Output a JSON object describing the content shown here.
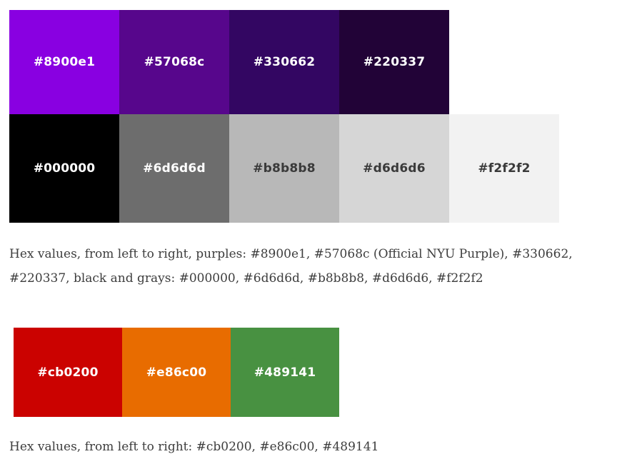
{
  "palettes": [
    {
      "swatches": [
        {
          "label": "#8900e1",
          "color": "#8900e1",
          "text_color": "#ffffff"
        },
        {
          "label": "#57068c",
          "color": "#57068c",
          "text_color": "#ffffff"
        },
        {
          "label": "#330662",
          "color": "#330662",
          "text_color": "#ffffff"
        },
        {
          "label": "#220337",
          "color": "#220337",
          "text_color": "#ffffff"
        }
      ]
    },
    {
      "swatches": [
        {
          "label": "#000000",
          "color": "#000000",
          "text_color": "#ffffff"
        },
        {
          "label": "#6d6d6d",
          "color": "#6d6d6d",
          "text_color": "#ffffff"
        },
        {
          "label": "#b8b8b8",
          "color": "#b8b8b8",
          "text_color": "#3a3a3a"
        },
        {
          "label": "#d6d6d6",
          "color": "#d6d6d6",
          "text_color": "#3a3a3a"
        },
        {
          "label": "#f2f2f2",
          "color": "#f2f2f2",
          "text_color": "#3a3a3a"
        }
      ]
    },
    {
      "swatches": [
        {
          "label": "#cb0200",
          "color": "#cb0200",
          "text_color": "#ffffff"
        },
        {
          "label": "#e86c00",
          "color": "#e86c00",
          "text_color": "#ffffff"
        },
        {
          "label": "#489141",
          "color": "#489141",
          "text_color": "#ffffff"
        }
      ]
    }
  ],
  "captions": [
    "Hex values, from left to right, purples: #8900e1, #57068c (Official NYU Purple), #330662, #220337, black and grays: #000000, #6d6d6d, #b8b8b8, #d6d6d6, #f2f2f2",
    "Hex values, from left to right: #cb0200, #e86c00, #489141"
  ]
}
